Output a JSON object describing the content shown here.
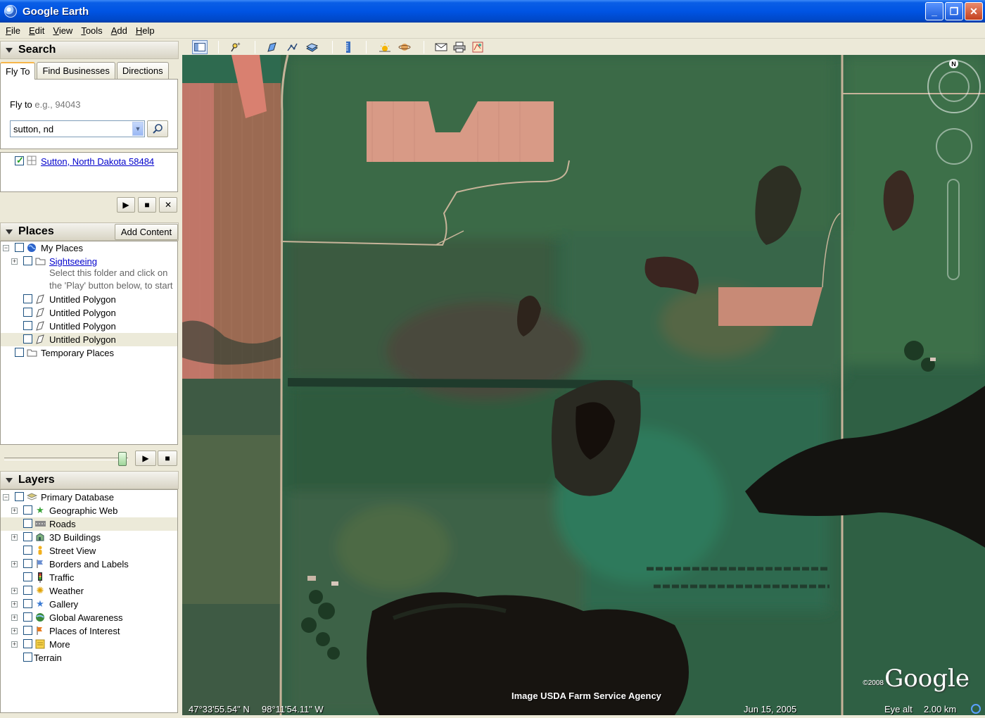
{
  "window": {
    "title": "Google Earth"
  },
  "menu": [
    "File",
    "Edit",
    "View",
    "Tools",
    "Add",
    "Help"
  ],
  "search": {
    "header": "Search",
    "tabs": [
      "Fly To",
      "Find Businesses",
      "Directions"
    ],
    "fly_to_label": "Fly to",
    "fly_to_hint": "e.g., 94043",
    "query": "sutton, nd",
    "result": "Sutton, North Dakota 58484"
  },
  "places": {
    "header": "Places",
    "add_content": "Add Content",
    "items": [
      {
        "label": "My Places"
      },
      {
        "label": "Sightseeing"
      },
      {
        "label": "Select this folder and click on the 'Play' button below, to start"
      },
      {
        "label": "Untitled Polygon"
      },
      {
        "label": "Untitled Polygon"
      },
      {
        "label": "Untitled Polygon"
      },
      {
        "label": "Untitled Polygon"
      },
      {
        "label": "Temporary Places"
      }
    ]
  },
  "layers": {
    "header": "Layers",
    "items": [
      {
        "label": "Primary Database"
      },
      {
        "label": "Geographic Web"
      },
      {
        "label": "Roads"
      },
      {
        "label": "3D Buildings"
      },
      {
        "label": "Street View"
      },
      {
        "label": "Borders and Labels"
      },
      {
        "label": "Traffic"
      },
      {
        "label": "Weather"
      },
      {
        "label": "Gallery"
      },
      {
        "label": "Global Awareness"
      },
      {
        "label": "Places of Interest"
      },
      {
        "label": "More"
      },
      {
        "label": "Terrain"
      }
    ]
  },
  "map": {
    "attribution": "Image USDA Farm Service Agency",
    "copyright": "©2008",
    "logo": "Google",
    "compass_n": "N",
    "latitude": "47°33'55.54\" N",
    "longitude": "98°11'54.11\" W",
    "date": "Jun 15, 2005",
    "eye_alt_label": "Eye alt",
    "eye_alt_value": "2.00 km"
  }
}
